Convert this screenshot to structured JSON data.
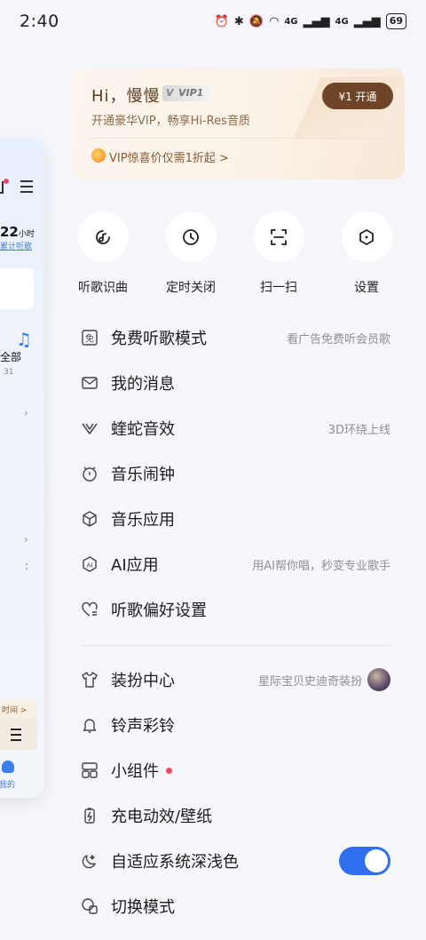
{
  "status_bar": {
    "time": "2:40",
    "signal_label": "4G",
    "battery": "69"
  },
  "background_panel": {
    "stat_value": "22",
    "stat_unit": "小时",
    "stat_sub": "累计听歌",
    "all_label": "全部",
    "all_count": "31",
    "time_chip": "时间 >",
    "mine_label": "我的"
  },
  "vip_card": {
    "greeting": "Hi，慢慢",
    "badge": "VIP1",
    "subtitle": "开通豪华VIP，畅享Hi-Res音质",
    "button": "¥1 开通",
    "promo": "VIP惊喜价仅需1折起 >"
  },
  "quick_actions": [
    {
      "label": "听歌识曲",
      "icon": "music-recognize-icon"
    },
    {
      "label": "定时关闭",
      "icon": "clock-icon"
    },
    {
      "label": "扫一扫",
      "icon": "scan-icon"
    },
    {
      "label": "设置",
      "icon": "settings-icon"
    }
  ],
  "menu": [
    {
      "label": "免费听歌模式",
      "hint": "看广告免费听会员歌",
      "icon": "free-icon"
    },
    {
      "label": "我的消息",
      "hint": "",
      "icon": "mail-icon"
    },
    {
      "label": "蝰蛇音效",
      "hint": "3D环绕上线",
      "icon": "viper-icon"
    },
    {
      "label": "音乐闹钟",
      "hint": "",
      "icon": "alarm-icon"
    },
    {
      "label": "音乐应用",
      "hint": "",
      "icon": "cube-icon"
    },
    {
      "label": "AI应用",
      "hint": "用AI帮你唱，秒变专业歌手",
      "icon": "ai-icon"
    },
    {
      "label": "听歌偏好设置",
      "hint": "",
      "icon": "heart-settings-icon"
    }
  ],
  "menu2": [
    {
      "label": "装扮中心",
      "hint": "星际宝贝史迪奇装扮",
      "icon": "shirt-icon"
    },
    {
      "label": "铃声彩铃",
      "hint": "",
      "icon": "bell-icon"
    },
    {
      "label": "小组件",
      "hint": "",
      "icon": "widget-icon"
    },
    {
      "label": "充电动效/壁纸",
      "hint": "",
      "icon": "battery-charge-icon"
    },
    {
      "label": "自适应系统深浅色",
      "hint": "",
      "icon": "moon-icon",
      "toggle_on": true
    },
    {
      "label": "切换模式",
      "hint": "",
      "icon": "switch-mode-icon"
    }
  ],
  "colors": {
    "accent": "#2f6ff0",
    "vip_brown": "#6e4526",
    "dot_red": "#ec4a61"
  }
}
